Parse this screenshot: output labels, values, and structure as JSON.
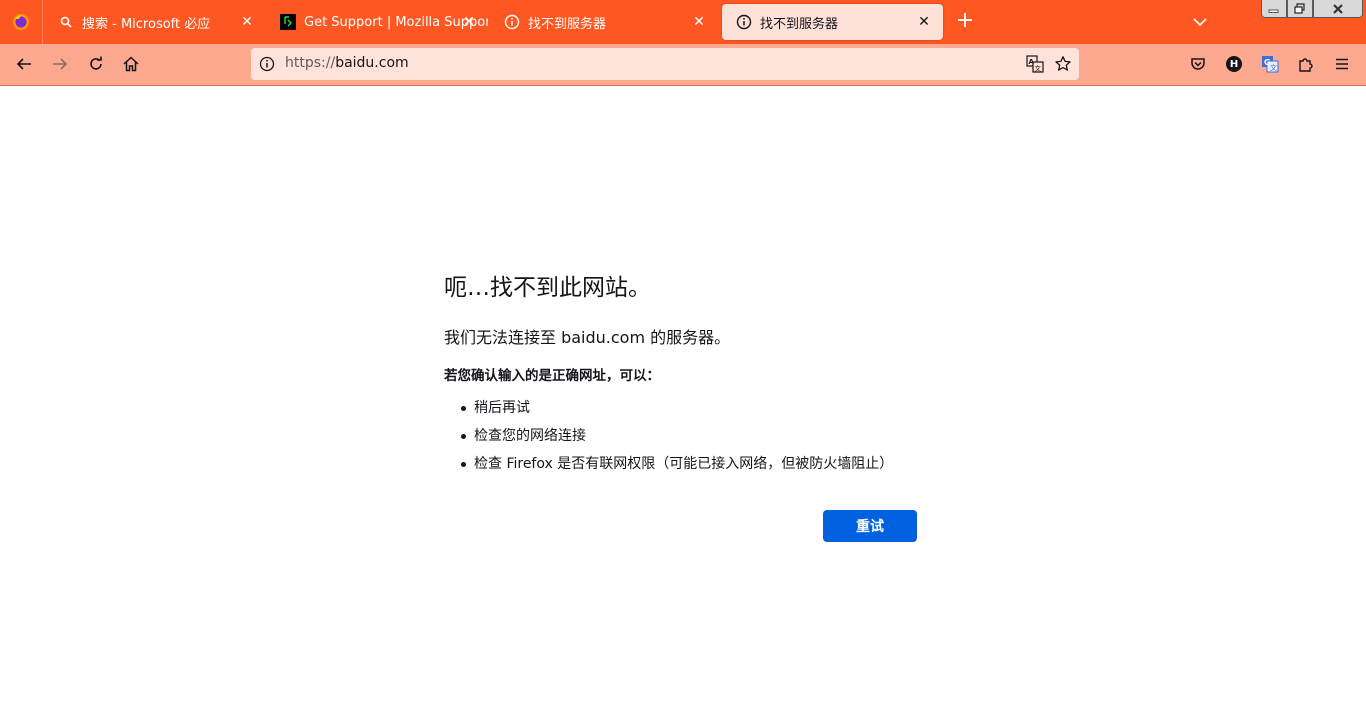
{
  "tabs": [
    {
      "title": "搜索 - Microsoft 必应",
      "icon": "search-favicon"
    },
    {
      "title": "Get Support | Mozilla Support",
      "icon": "mozilla-support-favicon"
    },
    {
      "title": "找不到服务器",
      "icon": "info-icon"
    },
    {
      "title": "找不到服务器",
      "icon": "info-icon",
      "active": true
    }
  ],
  "toolbar": {
    "url_scheme": "https://",
    "url_host": "baidu.com",
    "avatar_letter": "H"
  },
  "error_page": {
    "title": "呃…找不到此网站。",
    "description": "我们无法连接至 baidu.com 的服务器。",
    "hint": "若您确认输入的是正确网址，可以：",
    "suggestions": [
      "稍后再试",
      "检查您的网络连接",
      "检查 Firefox 是否有联网权限（可能已接入网络，但被防火墙阻止）"
    ],
    "retry_label": "重试"
  },
  "colors": {
    "tabbar": "#ff5722",
    "toolbar": "#fca98f",
    "urlbar": "#ffe2d9",
    "active_tab": "#fde0d8",
    "retry_button": "#0061e0"
  }
}
